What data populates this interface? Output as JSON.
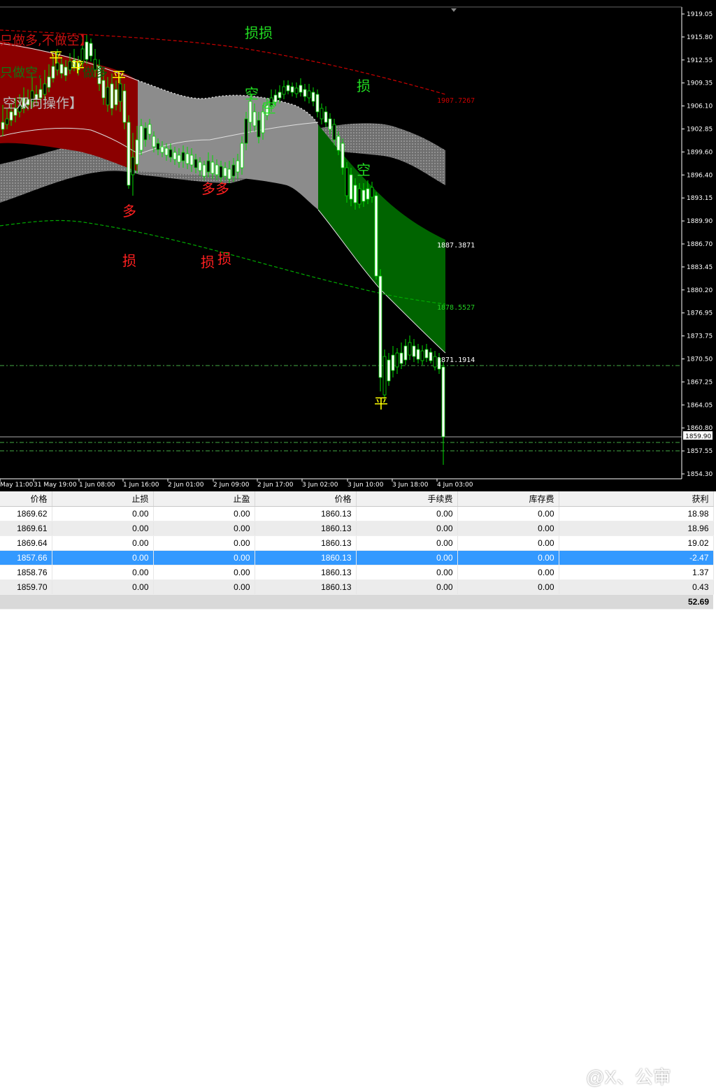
{
  "chart": {
    "price_axis_labels": [
      "1919.05",
      "1915.80",
      "1912.55",
      "1909.35",
      "1906.10",
      "1902.85",
      "1899.60",
      "1896.40",
      "1893.15",
      "1889.90",
      "1886.70",
      "1883.45",
      "1880.20",
      "1876.95",
      "1873.75",
      "1870.50",
      "1867.25",
      "1864.05",
      "1860.80",
      "1857.55",
      "1854.30"
    ],
    "current_price_label": "1859.90",
    "time_axis_labels": [
      "May 11:00",
      "31 May 19:00",
      "1 Jun 08:00",
      "1 Jun 16:00",
      "2 Jun 01:00",
      "2 Jun 09:00",
      "2 Jun 17:00",
      "3 Jun 02:00",
      "3 Jun 10:00",
      "3 Jun 18:00",
      "4 Jun 03:00"
    ],
    "level_labels": {
      "red_ma": "1907.7267",
      "upper_band": "1887.3871",
      "green_ma": "1878.5527",
      "lower_band": "1871.1914"
    },
    "header_texts": {
      "long_only": "只做多,不做空】",
      "short_only": "只做空,",
      "short_only_tail": "做多",
      "two_way": "空双向操作】"
    },
    "annotations": [
      {
        "text": "平",
        "color": "#ffff00"
      },
      {
        "text": "平",
        "color": "#ffff00"
      },
      {
        "text": "平",
        "color": "#ffff00"
      },
      {
        "text": "多",
        "color": "#ff2020"
      },
      {
        "text": "损",
        "color": "#ff2020"
      },
      {
        "text": "多多",
        "color": "#ff2020"
      },
      {
        "text": "损",
        "color": "#ff2020"
      },
      {
        "text": "损",
        "color": "#ff2020"
      },
      {
        "text": "损损",
        "color": "#22dd22"
      },
      {
        "text": "空",
        "color": "#22dd22"
      },
      {
        "text": "空",
        "color": "#22dd22"
      },
      {
        "text": "损",
        "color": "#22dd22"
      },
      {
        "text": "空",
        "color": "#22dd22"
      },
      {
        "text": "平",
        "color": "#ffff00"
      }
    ],
    "colors": {
      "background": "#000000",
      "bull_fill": "#ffffff",
      "bear_fill": "#000000",
      "wick": "#00dd00",
      "red_zone": "#8b0000",
      "gray_zone": "#8c8c8c",
      "green_zone": "#006400",
      "red_ma": "#cc0000",
      "green_ma": "#00aa00",
      "grid_line": "#44aa44"
    }
  },
  "table": {
    "headers": [
      "价格",
      "止损",
      "止盈",
      "价格",
      "手续费",
      "库存费",
      "获利"
    ],
    "rows": [
      {
        "price_open": "1869.62",
        "sl": "0.00",
        "tp": "0.00",
        "price": "1860.13",
        "commission": "0.00",
        "swap": "0.00",
        "profit": "18.98"
      },
      {
        "price_open": "1869.61",
        "sl": "0.00",
        "tp": "0.00",
        "price": "1860.13",
        "commission": "0.00",
        "swap": "0.00",
        "profit": "18.96"
      },
      {
        "price_open": "1869.64",
        "sl": "0.00",
        "tp": "0.00",
        "price": "1860.13",
        "commission": "0.00",
        "swap": "0.00",
        "profit": "19.02"
      },
      {
        "price_open": "1857.66",
        "sl": "0.00",
        "tp": "0.00",
        "price": "1860.13",
        "commission": "0.00",
        "swap": "0.00",
        "profit": "-2.47"
      },
      {
        "price_open": "1858.76",
        "sl": "0.00",
        "tp": "0.00",
        "price": "1860.13",
        "commission": "0.00",
        "swap": "0.00",
        "profit": "1.37"
      },
      {
        "price_open": "1859.70",
        "sl": "0.00",
        "tp": "0.00",
        "price": "1860.13",
        "commission": "0.00",
        "swap": "0.00",
        "profit": "0.43"
      }
    ],
    "total": "52.69"
  },
  "watermark": "@X、公审"
}
